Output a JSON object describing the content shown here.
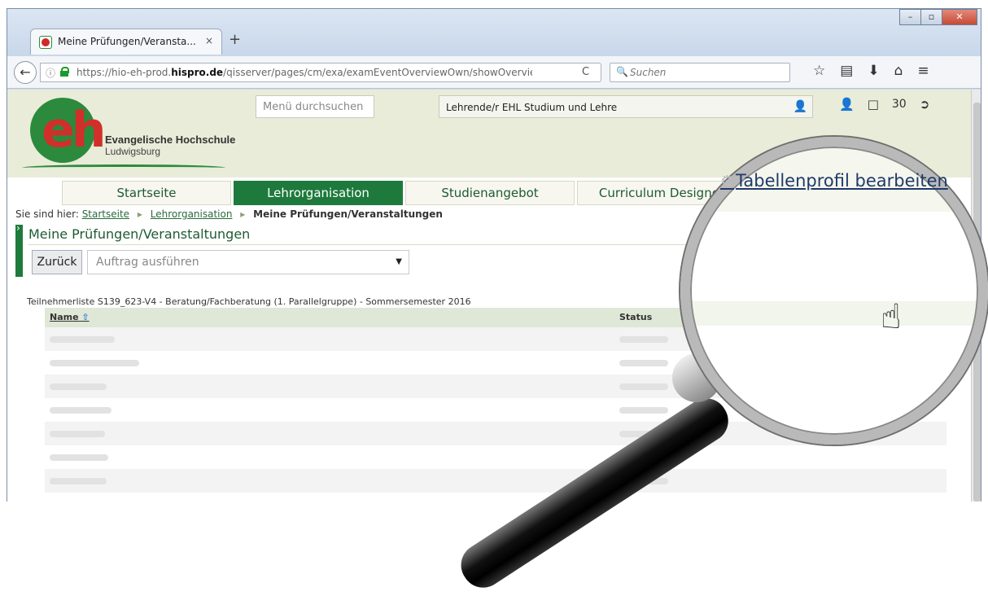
{
  "browser": {
    "tab_title": "Meine Prüfungen/Veransta...",
    "tab_close": "×",
    "new_tab": "+",
    "url_prefix": "https://hio-eh-prod.",
    "url_domain": "hispro.de",
    "url_rest": "/qisserver/pages/cm/exa/examEventOverviewOwn/showOverview.x",
    "search_placeholder": "Suchen",
    "back": "←",
    "reload": "C"
  },
  "window_buttons": {
    "minimize": "–",
    "maximize": "▫",
    "close": "✕"
  },
  "header": {
    "logo_title": "Evangelische Hochschule",
    "logo_subtitle": "Ludwigsburg",
    "menu_search_placeholder": "Menü durchsuchen",
    "role": "Lehrende/r EHL Studium und Lehre",
    "count": "30"
  },
  "nav": {
    "tabs": [
      {
        "label": "Startseite",
        "active": false
      },
      {
        "label": "Lehrorganisation",
        "active": true
      },
      {
        "label": "Studienangebot",
        "active": false
      },
      {
        "label": "Curriculum Designer",
        "active": false
      }
    ]
  },
  "breadcrumb": {
    "prefix": "Sie sind hier:",
    "items": [
      "Startseite",
      "Lehrorganisation"
    ],
    "current": "Meine Prüfungen/Veranstaltungen"
  },
  "section": {
    "title": "Meine Prüfungen/Veranstaltungen",
    "back_button": "Zurück",
    "action_placeholder": "Auftrag ausführen",
    "table_profile": "Tabellenprofil bearbeiten"
  },
  "list": {
    "title": "Teilnehmerliste S139_623-V4 - Beratung/Fachberatung (1. Parallelgruppe) - Sommersemester 2016",
    "columns": {
      "name": "Name",
      "status": "Status"
    },
    "sort_indicator": "⇧"
  }
}
